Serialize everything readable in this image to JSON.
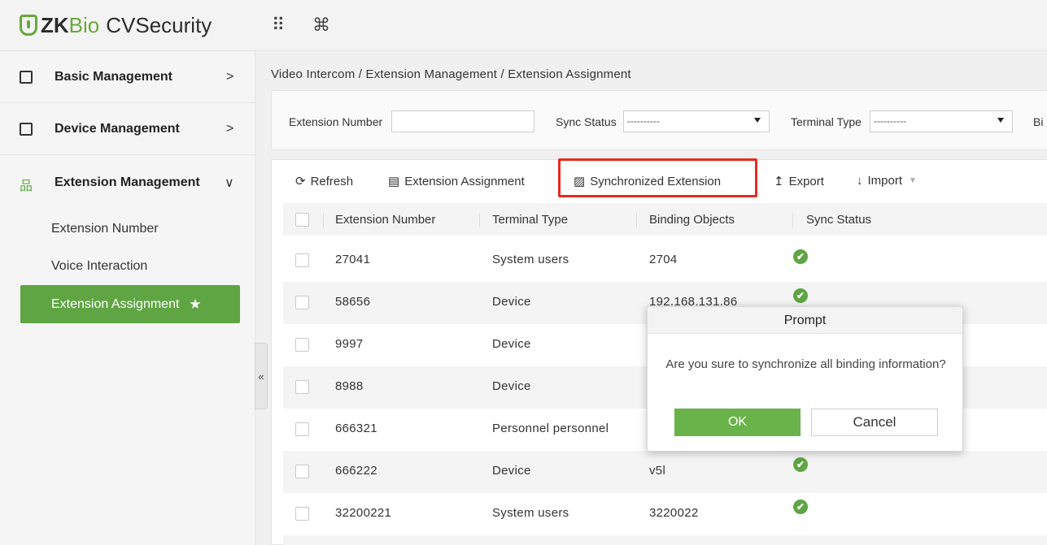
{
  "header": {
    "logo_zk": "ZK",
    "logo_bio": "Bio",
    "logo_cv": "CVSecurity",
    "apps_icon": "⠿",
    "command_icon": "⌘"
  },
  "sidebar": {
    "groups": [
      {
        "label": "Basic Management",
        "icon": "grid-icon",
        "arrow": ">"
      },
      {
        "label": "Device Management",
        "icon": "device-icon",
        "arrow": ">"
      },
      {
        "label": "Extension Management",
        "icon": "network-icon",
        "arrow": "∨"
      }
    ],
    "sub_items": [
      "Extension Number",
      "Voice Interaction"
    ],
    "active_item": "Extension Assignment",
    "star": "★",
    "collapse": "«"
  },
  "breadcrumb": "Video Intercom / Extension Management / Extension Assignment",
  "filters": {
    "extension_number_label": "Extension Number",
    "extension_number_value": "",
    "sync_status_label": "Sync Status",
    "sync_status_value": "----------",
    "terminal_type_label": "Terminal Type",
    "terminal_type_value": "----------",
    "cut_label": "Bi"
  },
  "toolbar": {
    "refresh": "Refresh",
    "extension_assignment": "Extension Assignment",
    "synchronized_extension": "Synchronized Extension",
    "export": "Export",
    "import": "Import"
  },
  "table": {
    "columns": [
      "Extension Number",
      "Terminal Type",
      "Binding Objects",
      "Sync Status"
    ],
    "rows": [
      {
        "ext": "27041",
        "type": "System users",
        "binding": "2704",
        "sync": "✔"
      },
      {
        "ext": "58656",
        "type": "Device",
        "binding": "192.168.131.86",
        "sync": "✔"
      },
      {
        "ext": "9997",
        "type": "Device",
        "binding": "",
        "sync": ""
      },
      {
        "ext": "8988",
        "type": "Device",
        "binding": "",
        "sync": ""
      },
      {
        "ext": "666321",
        "type": "Personnel personnel",
        "binding": "",
        "sync": ""
      },
      {
        "ext": "666222",
        "type": "Device",
        "binding": "v5l",
        "sync": "✔"
      },
      {
        "ext": "32200221",
        "type": "System users",
        "binding": "3220022",
        "sync": "✔"
      }
    ]
  },
  "dialog": {
    "title": "Prompt",
    "message": "Are you sure to synchronize all binding information?",
    "ok": "OK",
    "cancel": "Cancel"
  },
  "colors": {
    "accent_green": "#5fa543",
    "highlight_red": "#e8291f"
  }
}
